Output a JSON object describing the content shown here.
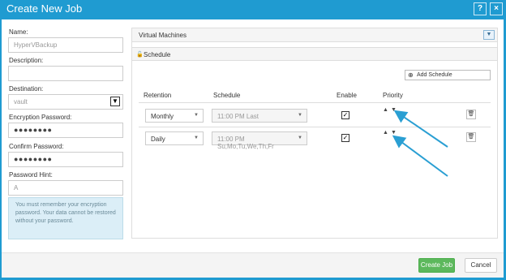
{
  "window": {
    "title": "Create New Job",
    "help_label": "?",
    "close_label": "×"
  },
  "form": {
    "name_label": "Name:",
    "name_value": "HyperVBackup",
    "description_label": "Description:",
    "description_value": "",
    "destination_label": "Destination:",
    "destination_value": "vault",
    "encryption_label": "Encryption Password:",
    "encryption_value": "●●●●●●●●",
    "confirm_label": "Confirm Password:",
    "confirm_value": "●●●●●●●●",
    "hint_label": "Password Hint:",
    "hint_value": "A",
    "note": "You must remember your encryption password. Your data cannot be restored without your password."
  },
  "panel": {
    "vm_title": "Virtual Machines",
    "schedule_title": "Schedule",
    "add_schedule": "Add Schedule",
    "headers": {
      "retention": "Retention",
      "schedule": "Schedule",
      "enable": "Enable",
      "priority": "Priority"
    },
    "rows": [
      {
        "retention": "Monthly",
        "schedule": "11:00 PM Last",
        "enabled": "✓"
      },
      {
        "retention": "Daily",
        "schedule": "11:00 PM Su,Mo,Tu,We,Th,Fr",
        "enabled": "✓"
      }
    ]
  },
  "footer": {
    "create_label": "Create Job",
    "cancel_label": "Cancel"
  },
  "colors": {
    "titlebar": "#1f9bd1",
    "accent_arrow": "#2a9fd3",
    "create_button": "#5cb85c"
  },
  "icons": {
    "vm_toggle": "chevron-down-icon",
    "schedule": "unlock-icon",
    "add": "plus-circle-icon",
    "delete": "trash-icon",
    "priority_up": "triangle-up-icon",
    "priority_down": "triangle-down-icon"
  }
}
